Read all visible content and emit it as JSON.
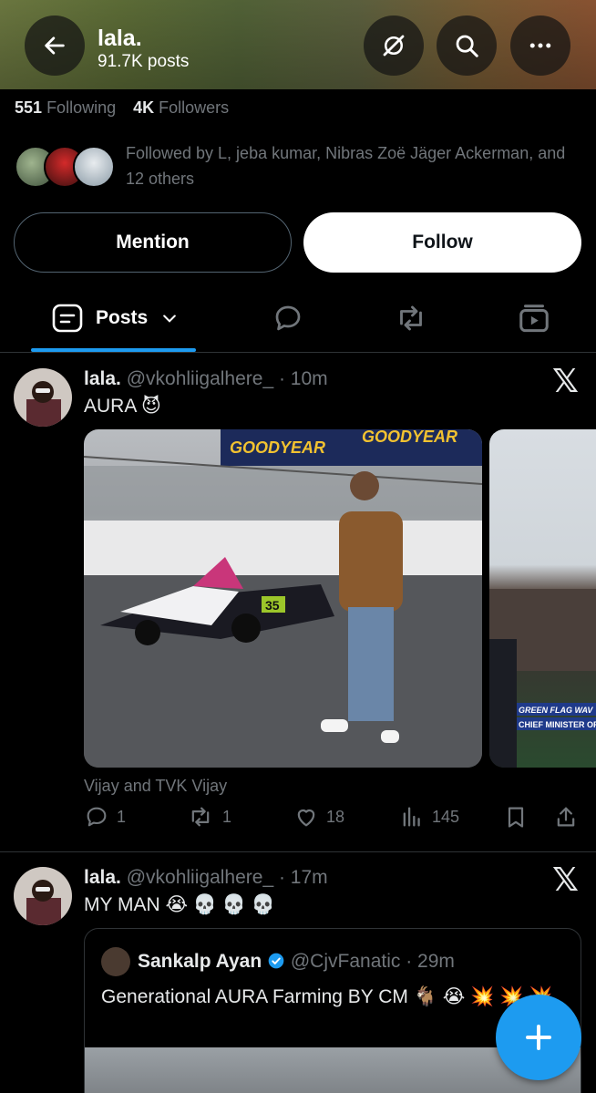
{
  "header": {
    "title": "lala.",
    "posts_count": "91.7K posts",
    "back_icon": "arrow-left-icon",
    "grok_icon": "grok-icon",
    "search_icon": "search-icon",
    "more_icon": "more-horizontal-icon"
  },
  "profile": {
    "following_count": "551",
    "following_label": "Following",
    "followers_count": "4K",
    "followers_label": "Followers",
    "followed_by": "Followed by L, jeba kumar, Nibras Zoë Jäger Ackerman, and 12 others"
  },
  "buttons": {
    "mention": "Mention",
    "follow": "Follow"
  },
  "tabs": {
    "posts_label": "Posts",
    "replies_icon": "reply-icon",
    "reposts_icon": "repost-icon",
    "media_icon": "media-icon"
  },
  "tweets": [
    {
      "name": "lala.",
      "handle": "@vkohliigalhere_",
      "time": "· 10m",
      "text": "AURA 😈",
      "caption": "Vijay and TVK Vijay",
      "media_main": {
        "banner_text_1": "GOODYEAR",
        "banner_text_2": "GOODYEAR",
        "car_number": "35"
      },
      "media_second": {
        "ticker_1": "GREEN FLAG WAV",
        "ticker_2": "CHIEF MINISTER OF"
      },
      "replies": "1",
      "reposts": "1",
      "likes": "18",
      "views": "145"
    },
    {
      "name": "lala.",
      "handle": "@vkohliigalhere_",
      "time": "· 17m",
      "text": "MY MAN 😭 💀 💀 💀",
      "quote": {
        "name": "Sankalp Ayan",
        "handle": "@CjvFanatic",
        "time": "· 29m",
        "text": "Generational AURA Farming BY CM 🐐 😭 💥 💥 💥"
      }
    }
  ],
  "colors": {
    "accent": "#1d9bf0",
    "background": "#000000",
    "muted": "#71767b",
    "border": "#2f3336"
  }
}
